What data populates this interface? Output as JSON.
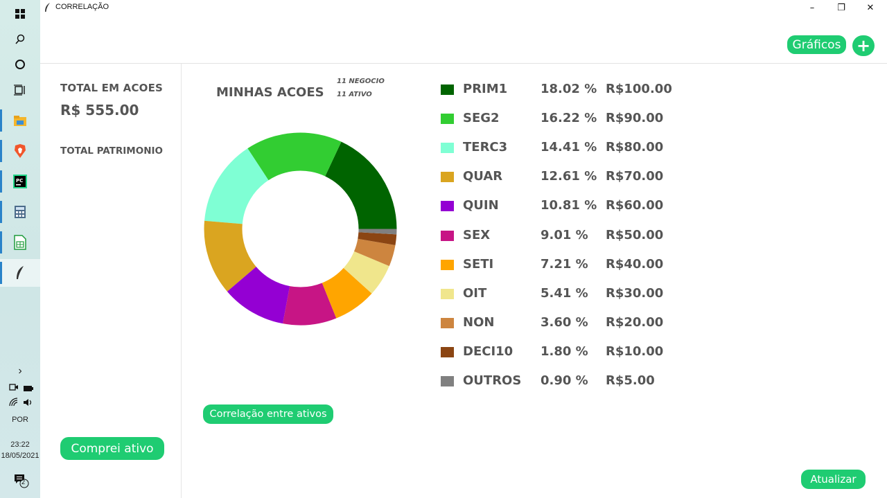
{
  "window": {
    "title": "CORRELAÇÃO",
    "minimize": "–",
    "restore": "❐",
    "close": "✕"
  },
  "taskbar": {
    "apps": [
      {
        "name": "start-icon",
        "glyph": "⊞"
      },
      {
        "name": "search-icon",
        "glyph": "⚲"
      },
      {
        "name": "cortana-icon",
        "glyph": "○"
      },
      {
        "name": "task-view-icon",
        "glyph": "⧉"
      },
      {
        "name": "file-explorer-icon",
        "glyph": "▬"
      },
      {
        "name": "brave-browser-icon",
        "glyph": "▼"
      },
      {
        "name": "pycharm-icon",
        "glyph": "PC"
      },
      {
        "name": "calculator-icon",
        "glyph": "▦"
      },
      {
        "name": "spreadsheet-icon",
        "glyph": "▤"
      },
      {
        "name": "feather-app-icon",
        "glyph": "✒"
      }
    ],
    "tray_chevron": "›",
    "language": "POR",
    "time": "23:22",
    "date": "18/05/2021",
    "notifications": "2"
  },
  "header": {
    "graficos_label": "Gráficos",
    "add_label": "+"
  },
  "left_panel": {
    "total_acoes_label": "TOTAL EM ACOES",
    "total_acoes_value": "R$ 555.00",
    "total_patrimonio_label": "TOTAL PATRIMONIO",
    "comprei_label": "Comprei ativo"
  },
  "main": {
    "chart_title": "MINHAS ACOES",
    "negocio": "11 NEGOCIO",
    "ativo": "11 ATIVO",
    "correlacao_label": "Correlação entre ativos",
    "atualizar_label": "Atualizar"
  },
  "chart_data": {
    "type": "pie",
    "donut": true,
    "title": "MINHAS ACOES",
    "categories": [
      "PRIM1",
      "SEG2",
      "TERC3",
      "QUAR",
      "QUIN",
      "SEX",
      "SETI",
      "OIT",
      "NON",
      "DECI10",
      "OUTROS"
    ],
    "values": [
      100,
      90,
      80,
      70,
      60,
      50,
      40,
      30,
      20,
      10,
      5
    ],
    "percent_labels": [
      "18.02 %",
      "16.22 %",
      "14.41 %",
      "12.61 %",
      "10.81 %",
      "9.01 %",
      "7.21 %",
      "5.41 %",
      "3.60 %",
      "1.80 %",
      "0.90 %"
    ],
    "value_labels": [
      "R$100.00",
      "R$90.00",
      "R$80.00",
      "R$70.00",
      "R$60.00",
      "R$50.00",
      "R$40.00",
      "R$30.00",
      "R$20.00",
      "R$10.00",
      "R$5.00"
    ],
    "colors": [
      "#006400",
      "#32cd32",
      "#7fffd4",
      "#daa520",
      "#9400d3",
      "#c71585",
      "#ffa500",
      "#f0e68c",
      "#cd853f",
      "#8b4513",
      "#808080"
    ],
    "legend_position": "right"
  }
}
